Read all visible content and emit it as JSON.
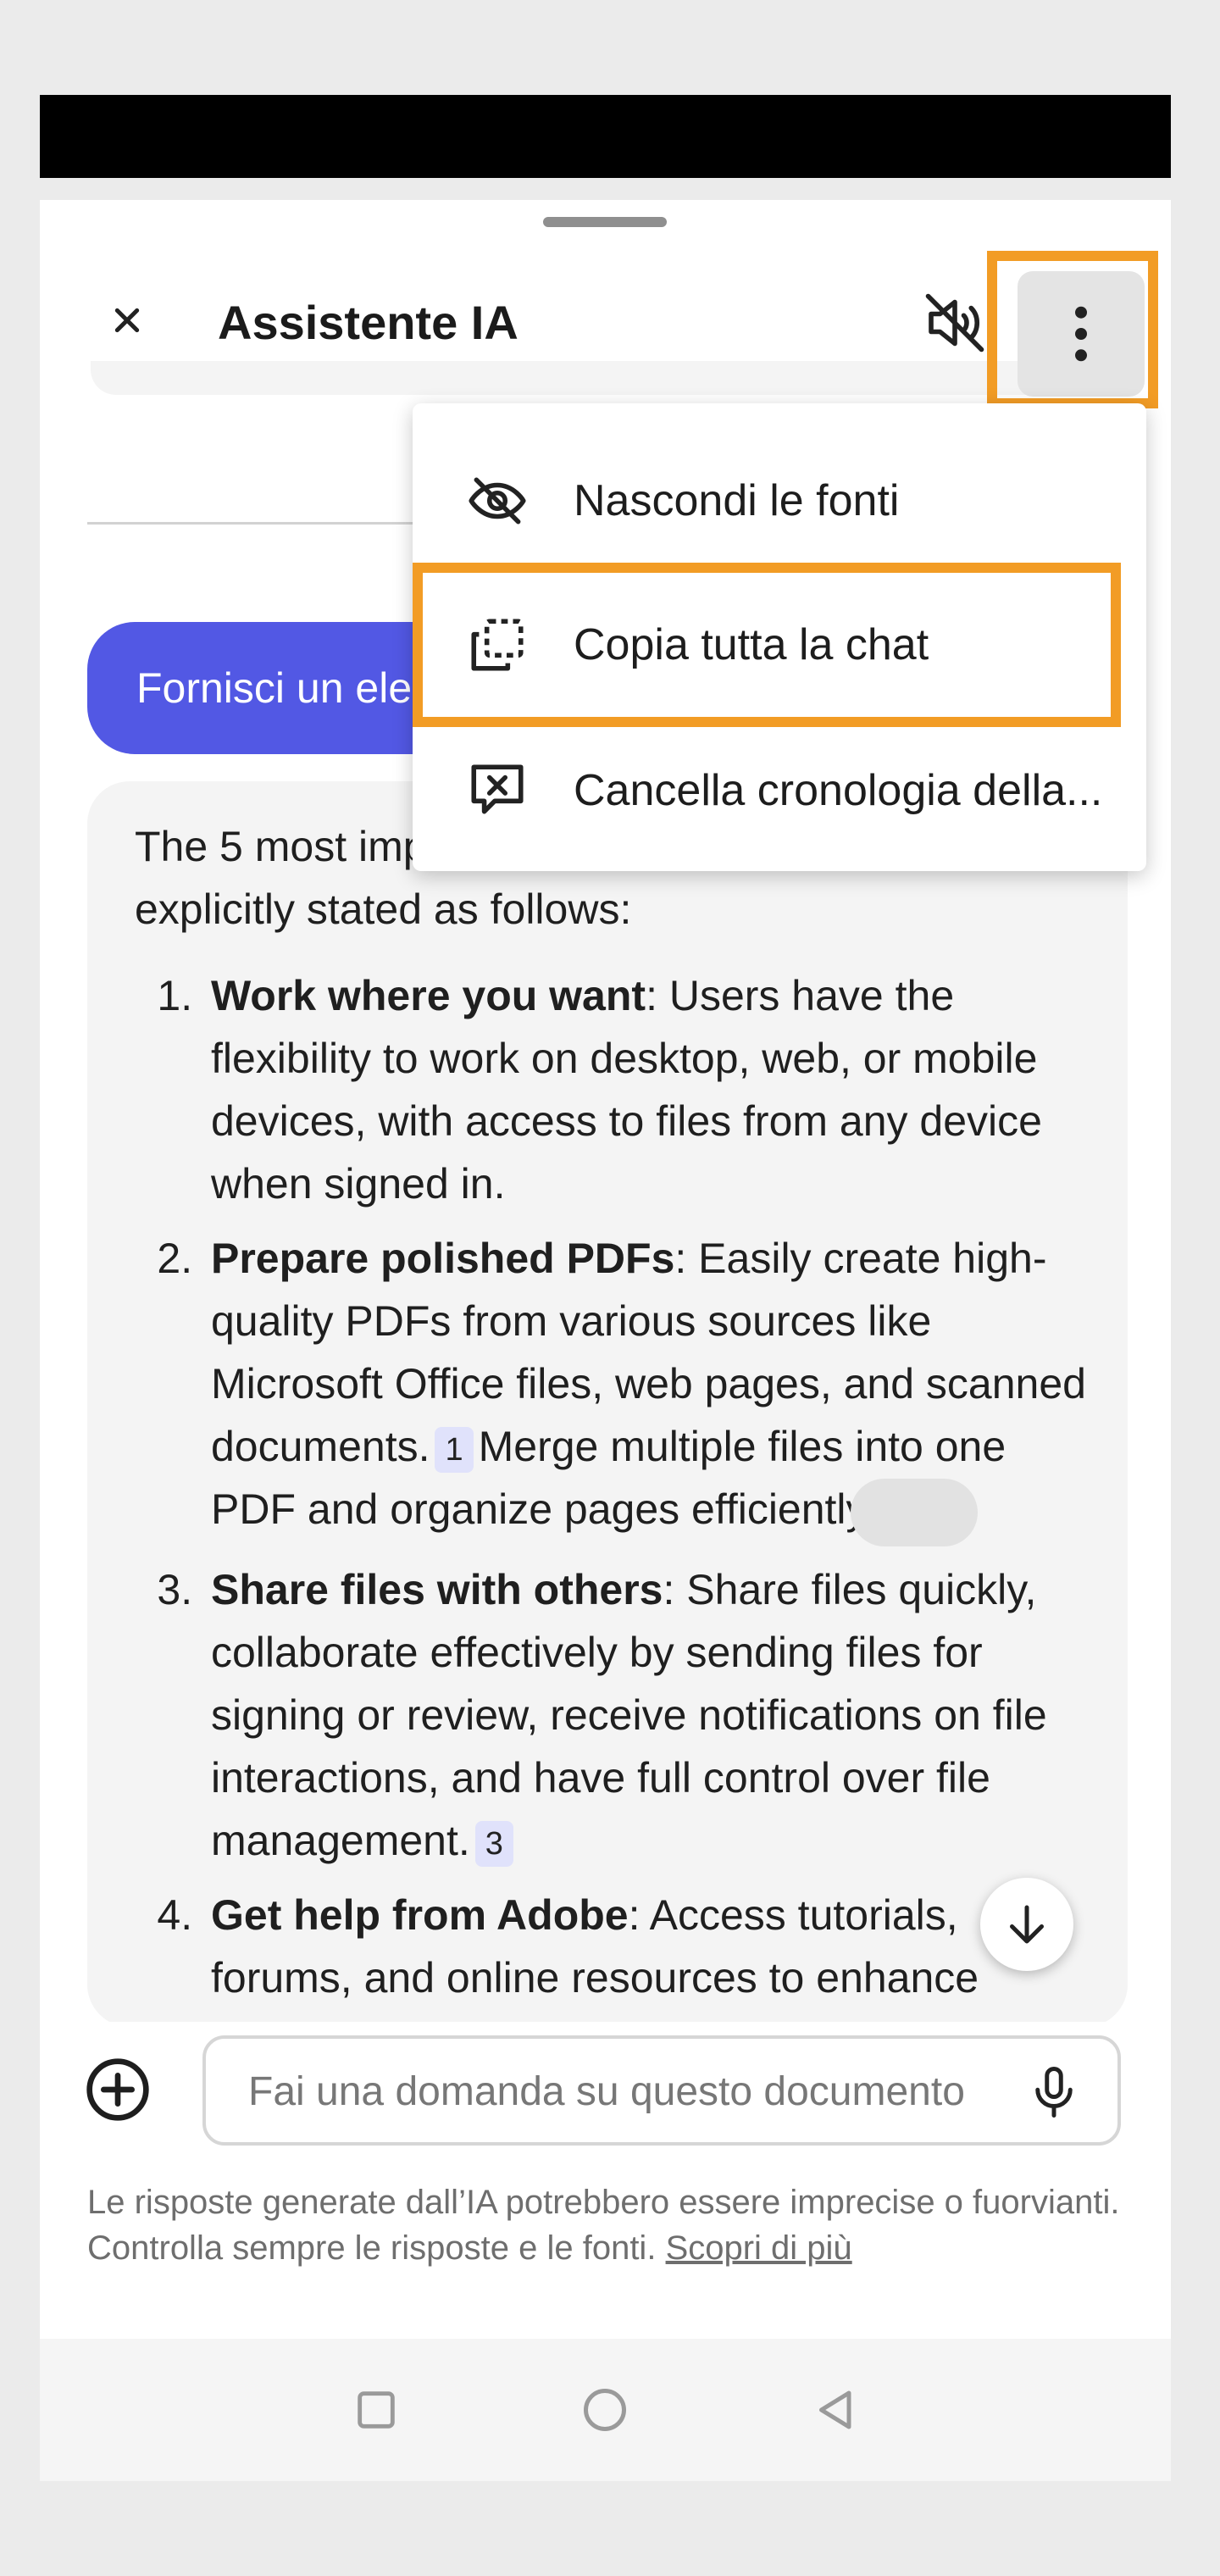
{
  "header": {
    "title": "Assistente IA"
  },
  "chat": {
    "user_message": "Fornisci un elenco",
    "answer_intro": "The 5 most important features of the document are explicitly stated as follows:",
    "items": [
      {
        "title": "Work where you want",
        "text": ": Users have the flexibility to work on desktop, web, or mobile devices, with access to files from any device when signed in."
      },
      {
        "title": "Prepare polished PDFs",
        "text": ": Easily create high-quality PDFs from various sources like Microsoft Office files, web pages, and scanned documents.",
        "cite": "1",
        "text2": "Merge multiple files into one PDF and organize pages efficiently"
      },
      {
        "title": "Share files with others",
        "text": ": Share files quickly, collaborate effectively by sending files for signing or review, receive notifications on file interactions, and have full control over file management.",
        "cite": "3"
      },
      {
        "title": "Get help from Adobe",
        "text": ": Access tutorials, forums, and online resources to enhance"
      }
    ]
  },
  "menu": {
    "items": [
      {
        "label": "Nascondi le fonti",
        "icon": "eye-off-icon"
      },
      {
        "label": "Copia tutta la chat",
        "icon": "copy-icon"
      },
      {
        "label": "Cancella cronologia della...",
        "icon": "clear-chat-icon"
      }
    ]
  },
  "input": {
    "placeholder": "Fai una domanda su questo documento"
  },
  "disclaimer": {
    "text": "Le risposte generate dall’IA potrebbero essere imprecise o fuorvianti. Controlla sempre le risposte e le fonti.",
    "link": "Scopri di più"
  },
  "colors": {
    "accent": "#5258e4",
    "highlight": "#f29c25"
  }
}
